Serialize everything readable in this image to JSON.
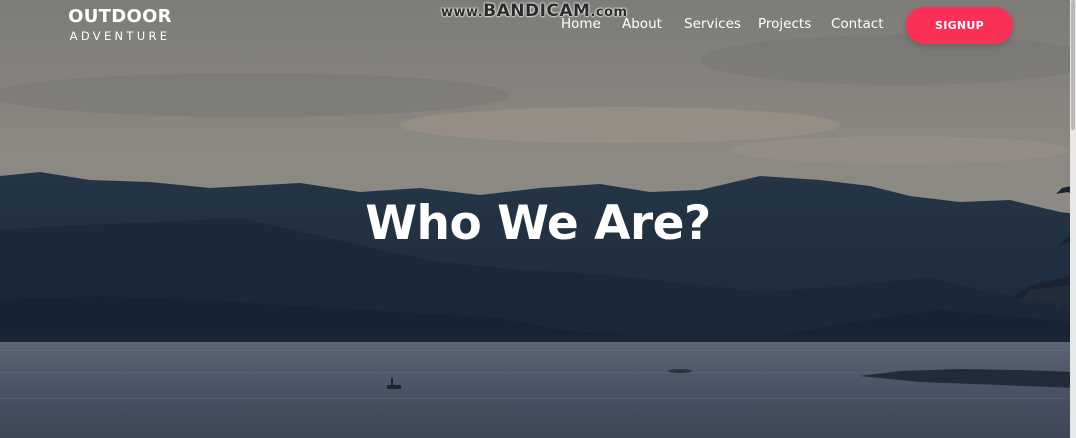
{
  "watermark": {
    "prefix": "www.",
    "brand": "BANDICAM",
    "suffix": ".com"
  },
  "logo": {
    "line1": "OUTDOOR",
    "line2": "ADVENTURE"
  },
  "nav": {
    "items": [
      {
        "label": "Home"
      },
      {
        "label": "About"
      },
      {
        "label": "Services"
      },
      {
        "label": "Projects"
      },
      {
        "label": "Contact"
      }
    ],
    "signup_label": "SIGNUP"
  },
  "hero": {
    "headline": "Who We Are?"
  },
  "colors": {
    "accent": "#fb3057",
    "text": "#ffffff",
    "sky": "#8a8a86",
    "mountains": "#1e2f40",
    "water": "#4e5868"
  },
  "icons": {
    "background": "landscape-photo"
  }
}
